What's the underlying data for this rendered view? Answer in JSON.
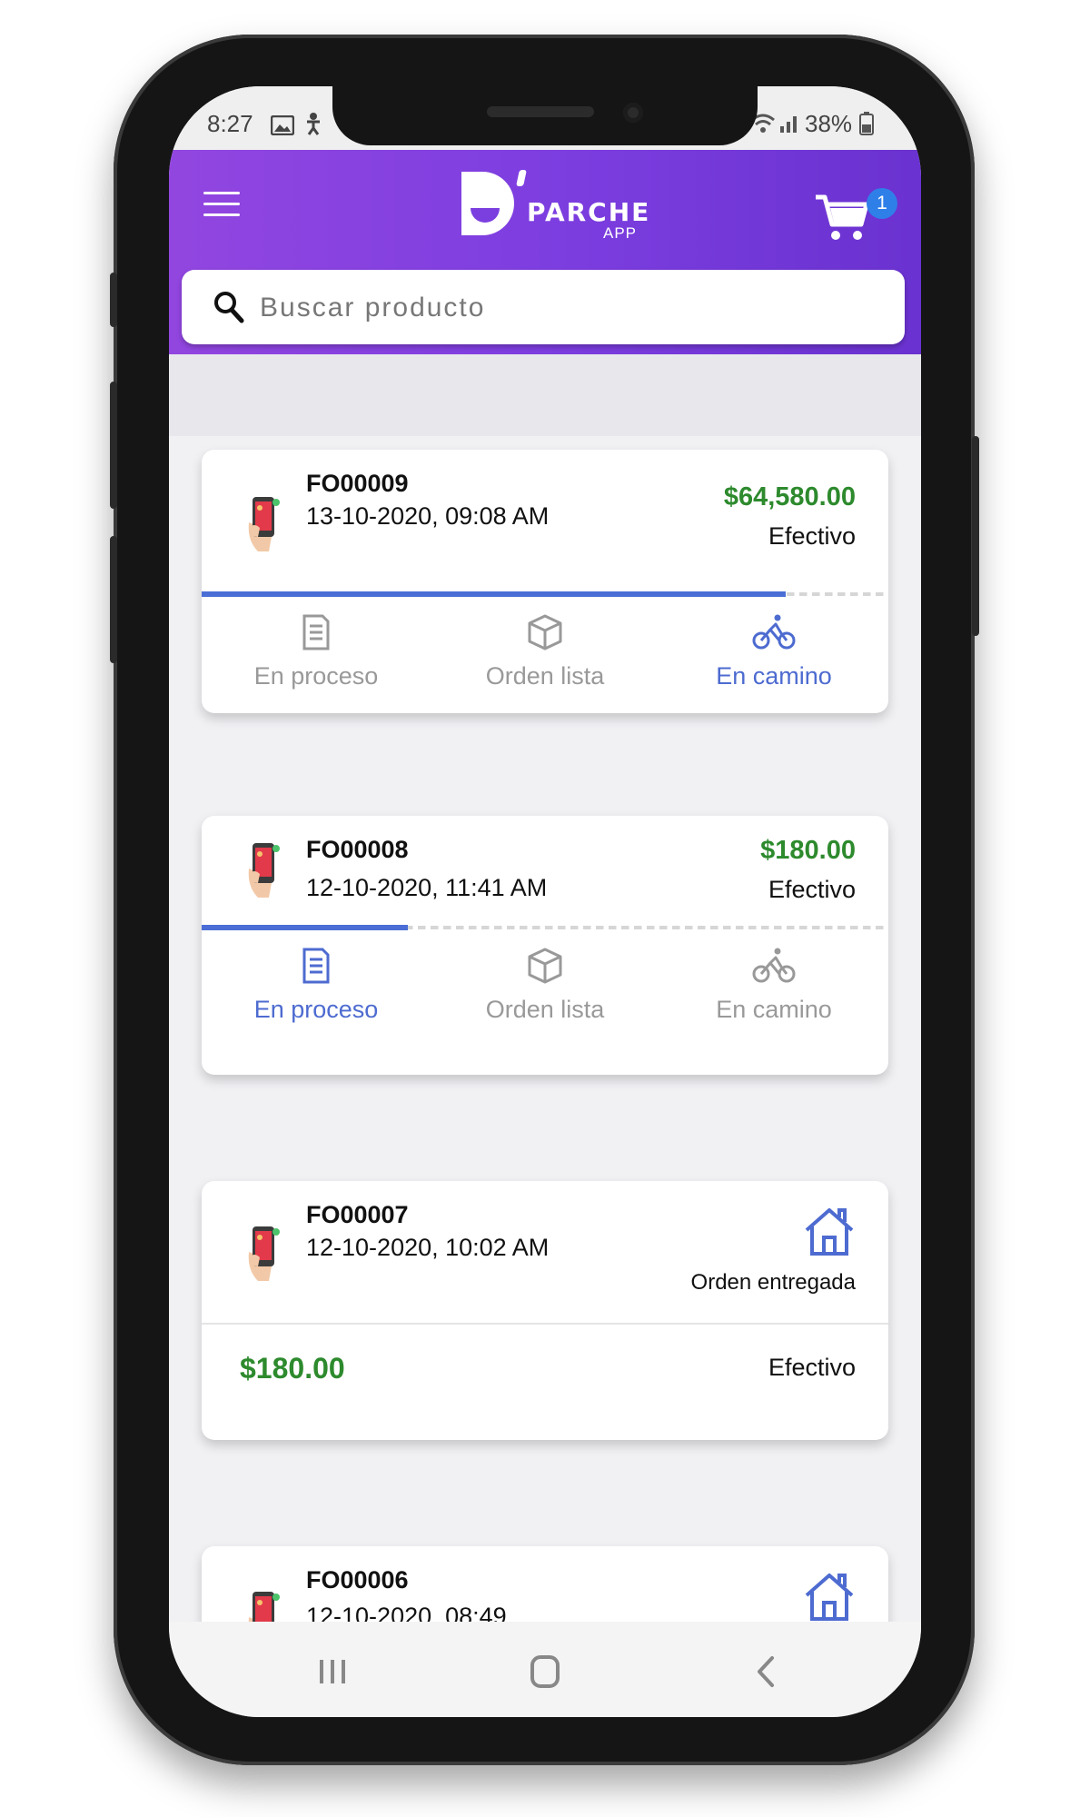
{
  "status_bar": {
    "time": "8:27",
    "battery": "38%"
  },
  "header": {
    "logo_text": "PARCHE",
    "logo_sub": "APP",
    "cart_count": "1"
  },
  "search": {
    "placeholder": "Buscar producto"
  },
  "orders": [
    {
      "id": "FO00009",
      "date": "13-10-2020, 09:08 AM",
      "price": "$64,580.00",
      "method": "Efectivo",
      "progress": 0.85,
      "steps": [
        {
          "label": "En proceso",
          "active": false
        },
        {
          "label": "Orden lista",
          "active": false
        },
        {
          "label": "En camino",
          "active": true
        }
      ]
    },
    {
      "id": "FO00008",
      "date": "12-10-2020, 11:41 AM",
      "price": "$180.00",
      "method": "Efectivo",
      "progress": 0.3,
      "steps": [
        {
          "label": "En proceso",
          "active": true
        },
        {
          "label": "Orden lista",
          "active": false
        },
        {
          "label": "En camino",
          "active": false
        }
      ]
    },
    {
      "id": "FO00007",
      "date": "12-10-2020, 10:02 AM",
      "status": "Orden entregada",
      "price": "$180.00",
      "method": "Efectivo"
    },
    {
      "id": "FO00006",
      "date": "12-10-2020, 08:49"
    }
  ],
  "colors": {
    "header_start": "#9246e0",
    "header_end": "#6a32d0",
    "accent": "#4a6ed6",
    "price": "#2d8a2d"
  }
}
